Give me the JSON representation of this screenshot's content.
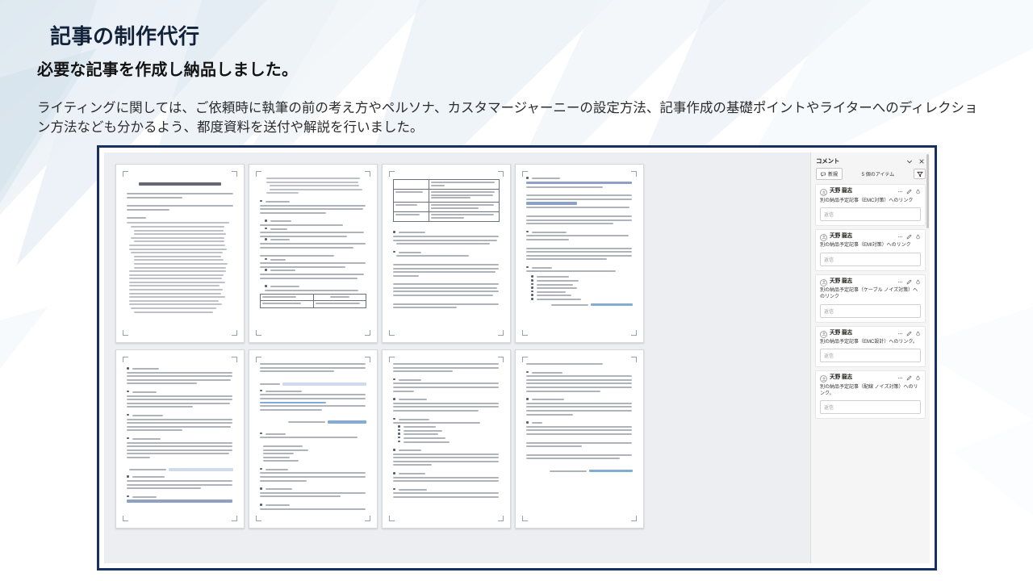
{
  "slide": {
    "title": "記事の制作代行",
    "subtitle": "必要な記事を作成し納品しました。",
    "body": "ライティングに関しては、ご依頼時に執筆の前の考え方やペルソナ、カスタマージャーニーの設定方法、記事作成の基礎ポイントやライターへのディレクション方法なども分かるよう、都度資料を送付や解説を行いました。"
  },
  "colors": {
    "frame_border": "#16305f",
    "title_text": "#13223b",
    "background_stripe": "#dde7f0",
    "app_chrome": "#eceef1",
    "comment_pane": "#f5f5f5"
  },
  "screenshot": {
    "app": "word-multi-page-view",
    "pages_count": 8,
    "comments_pane": {
      "title": "コメント",
      "collapse_icon": "chevron-down-icon",
      "close_icon": "close-icon",
      "new_button": {
        "label": "新規",
        "icon": "new-comment-icon"
      },
      "item_count_label": "5 個のアイテム",
      "filter_icon": "filter-icon",
      "reply_placeholder": "返信",
      "comments": [
        {
          "author": "天野 龍志",
          "text": "別の納品予定記事（EMC対策）へのリンク",
          "avatar_icon": "person-icon",
          "more_icon": "more-ellipsis-icon",
          "edit_icon": "pencil-edit-icon",
          "resolve_icon": "resolve-icon"
        },
        {
          "author": "天野 龍志",
          "text": "別の納品予定記事（EMI対策）へのリンク",
          "avatar_icon": "person-icon",
          "more_icon": "more-ellipsis-icon",
          "edit_icon": "pencil-edit-icon",
          "resolve_icon": "resolve-icon"
        },
        {
          "author": "天野 龍志",
          "text": "別の納品予定記事（ケーブル ノイズ対策）へのリンク",
          "avatar_icon": "person-icon",
          "more_icon": "more-ellipsis-icon",
          "edit_icon": "pencil-edit-icon",
          "resolve_icon": "resolve-icon"
        },
        {
          "author": "天野 龍志",
          "text": "別の納品予定記事（EMC設計）へのリンク。",
          "avatar_icon": "person-icon",
          "more_icon": "more-ellipsis-icon",
          "edit_icon": "pencil-edit-icon",
          "resolve_icon": "resolve-icon"
        },
        {
          "author": "天野 龍志",
          "text": "別の納品予定記事（配線 ノイズ対策）へのリンク。",
          "avatar_icon": "person-icon",
          "more_icon": "more-ellipsis-icon",
          "edit_icon": "pencil-edit-icon",
          "resolve_icon": "resolve-icon"
        }
      ]
    }
  }
}
